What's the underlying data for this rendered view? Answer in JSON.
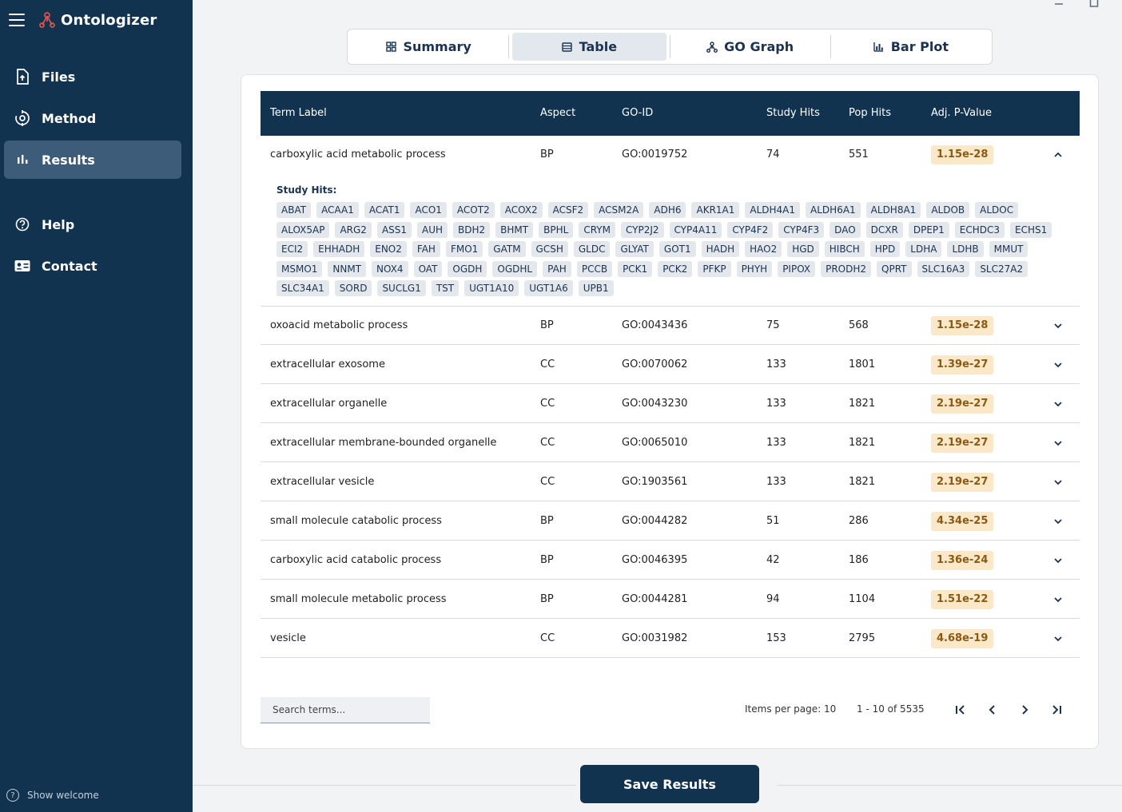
{
  "app": {
    "name": "Ontologizer"
  },
  "sidebar": {
    "items": [
      {
        "label": "Files",
        "icon": "file-upload-icon"
      },
      {
        "label": "Method",
        "icon": "method-icon"
      },
      {
        "label": "Results",
        "icon": "bar-chart-icon",
        "active": true
      },
      {
        "label": "Help",
        "icon": "help-circle-icon"
      },
      {
        "label": "Contact",
        "icon": "contact-card-icon"
      }
    ],
    "show_welcome": "Show welcome"
  },
  "tabs": [
    {
      "label": "Summary",
      "icon": "grid-icon"
    },
    {
      "label": "Table",
      "icon": "table-icon",
      "active": true
    },
    {
      "label": "GO Graph",
      "icon": "graph-icon"
    },
    {
      "label": "Bar Plot",
      "icon": "bar-plot-icon"
    }
  ],
  "table": {
    "headers": [
      "Term Label",
      "Aspect",
      "GO-ID",
      "Study Hits",
      "Pop Hits",
      "Adj. P-Value"
    ],
    "rows": [
      {
        "term": "carboxylic acid metabolic process",
        "aspect": "BP",
        "go_id": "GO:0019752",
        "study_hits": "74",
        "pop_hits": "551",
        "p_value": "1.15e-28",
        "expanded": true
      },
      {
        "term": "oxoacid metabolic process",
        "aspect": "BP",
        "go_id": "GO:0043436",
        "study_hits": "75",
        "pop_hits": "568",
        "p_value": "1.15e-28"
      },
      {
        "term": "extracellular exosome",
        "aspect": "CC",
        "go_id": "GO:0070062",
        "study_hits": "133",
        "pop_hits": "1801",
        "p_value": "1.39e-27"
      },
      {
        "term": "extracellular organelle",
        "aspect": "CC",
        "go_id": "GO:0043230",
        "study_hits": "133",
        "pop_hits": "1821",
        "p_value": "2.19e-27"
      },
      {
        "term": "extracellular membrane-bounded organelle",
        "aspect": "CC",
        "go_id": "GO:0065010",
        "study_hits": "133",
        "pop_hits": "1821",
        "p_value": "2.19e-27"
      },
      {
        "term": "extracellular vesicle",
        "aspect": "CC",
        "go_id": "GO:1903561",
        "study_hits": "133",
        "pop_hits": "1821",
        "p_value": "2.19e-27"
      },
      {
        "term": "small molecule catabolic process",
        "aspect": "BP",
        "go_id": "GO:0044282",
        "study_hits": "51",
        "pop_hits": "286",
        "p_value": "4.34e-25"
      },
      {
        "term": "carboxylic acid catabolic process",
        "aspect": "BP",
        "go_id": "GO:0046395",
        "study_hits": "42",
        "pop_hits": "186",
        "p_value": "1.36e-24"
      },
      {
        "term": "small molecule metabolic process",
        "aspect": "BP",
        "go_id": "GO:0044281",
        "study_hits": "94",
        "pop_hits": "1104",
        "p_value": "1.51e-22"
      },
      {
        "term": "vesicle",
        "aspect": "CC",
        "go_id": "GO:0031982",
        "study_hits": "153",
        "pop_hits": "2795",
        "p_value": "4.68e-19"
      }
    ],
    "detail": {
      "title": "Study Hits:",
      "genes": [
        "ABAT",
        "ACAA1",
        "ACAT1",
        "ACO1",
        "ACOT2",
        "ACOX2",
        "ACSF2",
        "ACSM2A",
        "ADH6",
        "AKR1A1",
        "ALDH4A1",
        "ALDH6A1",
        "ALDH8A1",
        "ALDOB",
        "ALDOC",
        "ALOX5AP",
        "ARG2",
        "ASS1",
        "AUH",
        "BDH2",
        "BHMT",
        "BPHL",
        "CRYM",
        "CYP2J2",
        "CYP4A11",
        "CYP4F2",
        "CYP4F3",
        "DAO",
        "DCXR",
        "DPEP1",
        "ECHDC3",
        "ECHS1",
        "ECI2",
        "EHHADH",
        "ENO2",
        "FAH",
        "FMO1",
        "GATM",
        "GCSH",
        "GLDC",
        "GLYAT",
        "GOT1",
        "HADH",
        "HAO2",
        "HGD",
        "HIBCH",
        "HPD",
        "LDHA",
        "LDHB",
        "MMUT",
        "MSMO1",
        "NNMT",
        "NOX4",
        "OAT",
        "OGDH",
        "OGDHL",
        "PAH",
        "PCCB",
        "PCK1",
        "PCK2",
        "PFKP",
        "PHYH",
        "PIPOX",
        "PRODH2",
        "QPRT",
        "SLC16A3",
        "SLC27A2",
        "SLC34A1",
        "SORD",
        "SUCLG1",
        "TST",
        "UGT1A10",
        "UGT1A6",
        "UPB1"
      ]
    },
    "search": {
      "placeholder": "Search terms..."
    },
    "pagination": {
      "items_per_page": "Items per page: 10",
      "range": "1 - 10 of 5535"
    }
  },
  "actions": {
    "save_label": "Save Results"
  },
  "colors": {
    "navy": "#12334f",
    "active_nav": "#3d5c79",
    "badge_bg": "#fbe8c9",
    "badge_text": "#8a5a14",
    "logo_red": "#d9534f"
  }
}
